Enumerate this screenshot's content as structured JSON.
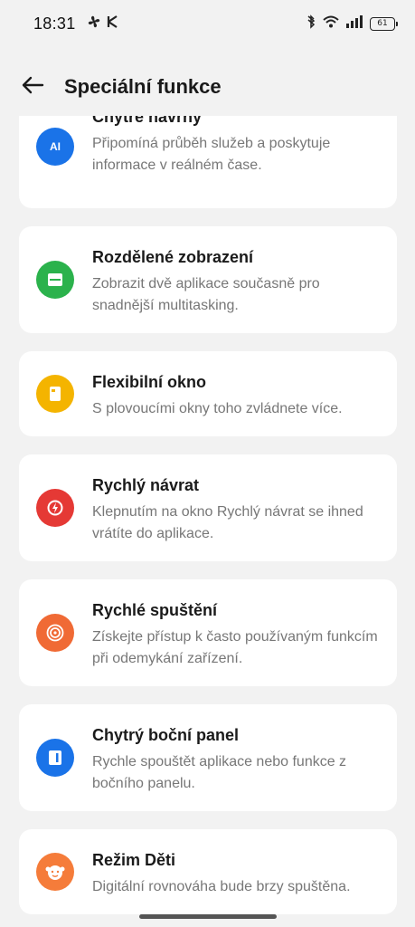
{
  "status": {
    "time": "18:31",
    "battery": "61"
  },
  "header": {
    "title": "Speciální funkce"
  },
  "items": [
    {
      "title": "Chytré návrhy",
      "desc": "Připomíná průběh služeb a poskytuje informace v reálném čase.",
      "icon": "ai-icon",
      "color": "#1a73e8",
      "glyph": "AI"
    },
    {
      "title": "Rozdělené zobrazení",
      "desc": "Zobrazit dvě aplikace současně pro snadnější multitasking.",
      "icon": "split-screen-icon",
      "color": "#2bb24c",
      "glyph": ""
    },
    {
      "title": "Flexibilní okno",
      "desc": "S plovoucími okny toho zvládnete více.",
      "icon": "flexible-window-icon",
      "color": "#f4b400",
      "glyph": ""
    },
    {
      "title": "Rychlý návrat",
      "desc": "Klepnutím na okno Rychlý návrat se ihned vrátíte do aplikace.",
      "icon": "quick-return-icon",
      "color": "#e53935",
      "glyph": ""
    },
    {
      "title": "Rychlé spuštění",
      "desc": "Získejte přístup k často používaným funkcím při odemykání zařízení.",
      "icon": "quick-launch-icon",
      "color": "#f06a35",
      "glyph": ""
    },
    {
      "title": "Chytrý boční panel",
      "desc": "Rychle spouštět aplikace nebo funkce z bočního panelu.",
      "icon": "side-panel-icon",
      "color": "#1a73e8",
      "glyph": ""
    },
    {
      "title": "Režim Děti",
      "desc": "Digitální rovnováha bude brzy spuštěna.",
      "icon": "kids-mode-icon",
      "color": "#f57c3a",
      "glyph": ""
    }
  ]
}
